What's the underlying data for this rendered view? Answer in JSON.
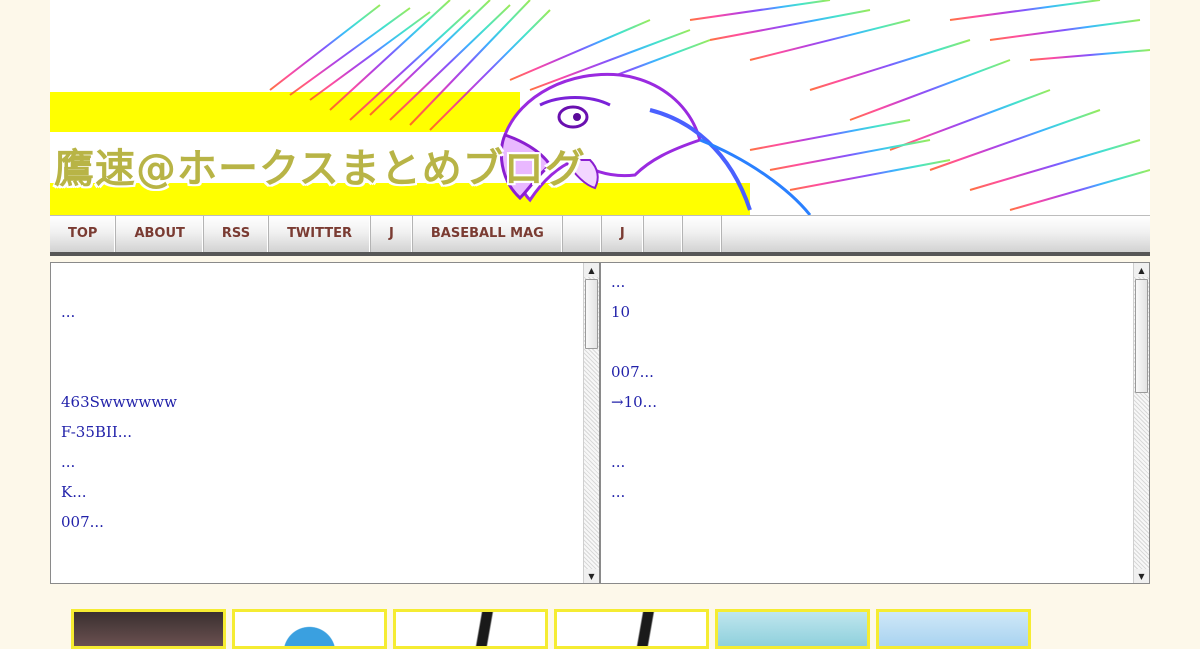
{
  "header": {
    "site_title": "鷹速@ホークスまとめブログ"
  },
  "nav": {
    "items": [
      {
        "label": "TOP"
      },
      {
        "label": "ABOUT"
      },
      {
        "label": "RSS"
      },
      {
        "label": "TWITTER"
      },
      {
        "label": "J"
      },
      {
        "label": "BASEBALL MAG"
      },
      {
        "label": ""
      },
      {
        "label": "J"
      },
      {
        "label": ""
      },
      {
        "label": ""
      }
    ]
  },
  "left_panel": {
    "items": [
      "",
      "...",
      "",
      "",
      "463Swwwwww",
      "F-35BII...",
      "...",
      "K...",
      "007..."
    ]
  },
  "right_panel": {
    "items": [
      "...",
      "10",
      "",
      "007...",
      "→10...",
      "",
      "...",
      "..."
    ]
  },
  "thumbnails": {
    "count_visible": 6
  },
  "colors": {
    "page_background": "#fdf8ea",
    "nav_text": "#7a3b32",
    "link_text": "#2222aa",
    "banner_yellow": "#ffff00",
    "thumb_border": "#f5ec32"
  }
}
